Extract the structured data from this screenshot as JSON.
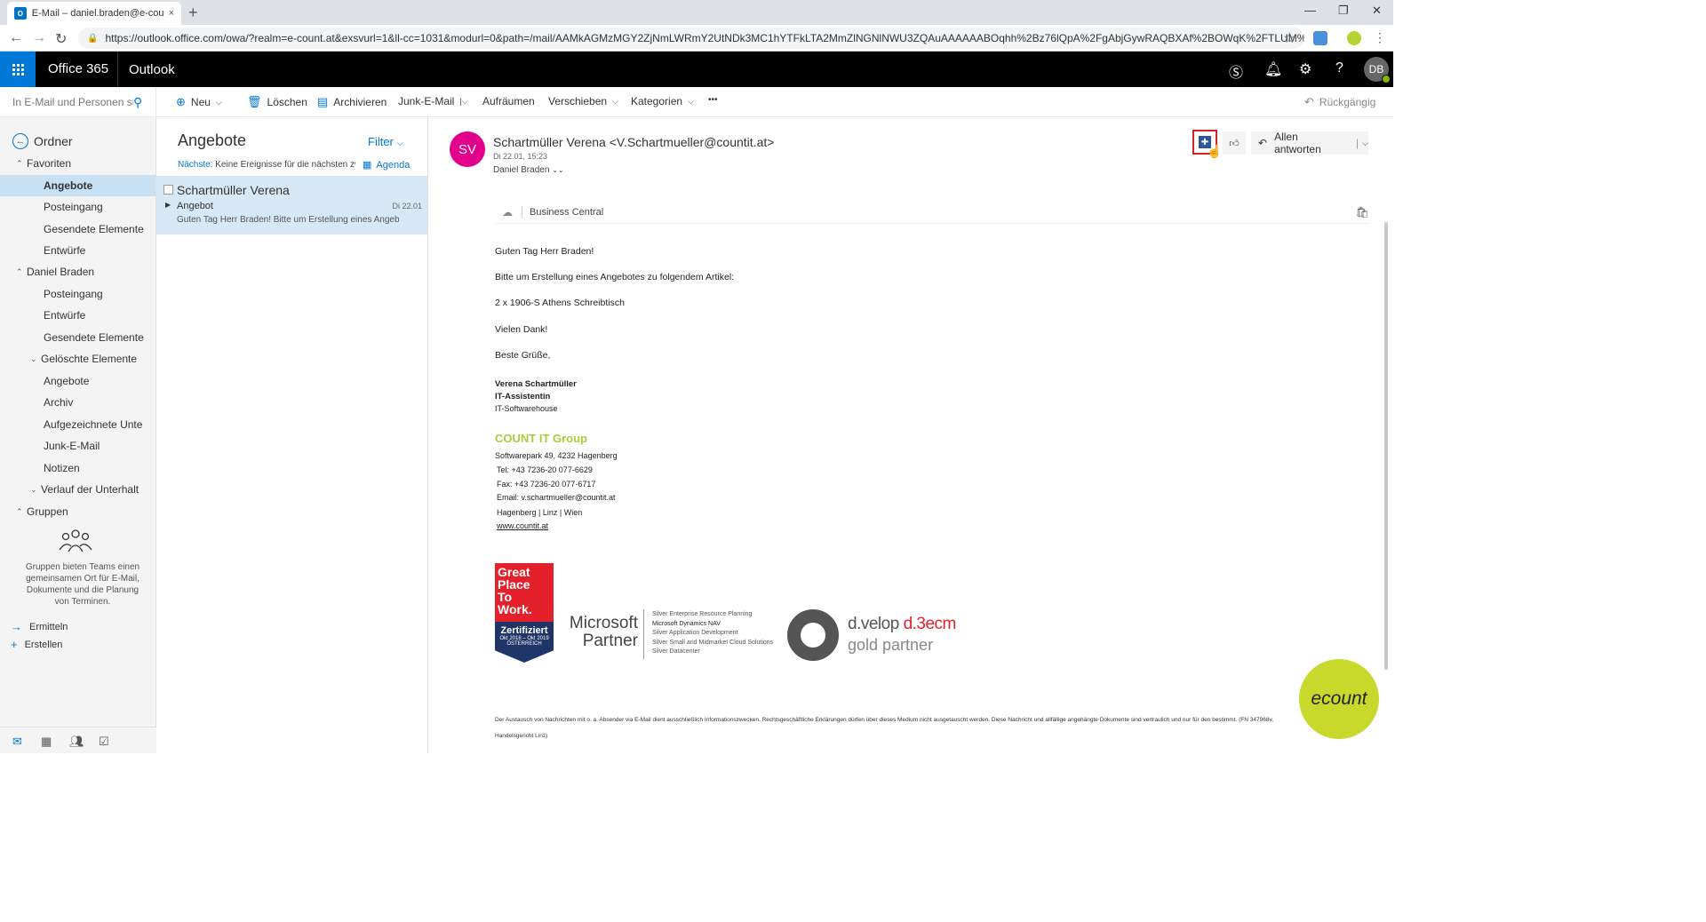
{
  "browser": {
    "tab_title": "E-Mail – daniel.braden@e-count…",
    "tab_close": "×",
    "new_tab": "+",
    "url": "https://outlook.office.com/owa/?realm=e-count.at&exsvurl=1&ll-cc=1031&modurl=0&path=/mail/AAMkAGMzMGY2ZjNmLWRmY2UtNDk3MC1hYTFkLTA2MmZlNGNlNWU3ZQAuAAAAAABOqhh%2Bz76lQpA%2FgAbjGywRAQBXAf%2BOWqK%2FTLUM%2Bnm..."
  },
  "suite": {
    "brand": "Office 365",
    "app": "Outlook"
  },
  "search": {
    "placeholder": "In E-Mail und Personen su..."
  },
  "commands": {
    "new": "Neu",
    "delete": "Löschen",
    "archive": "Archivieren",
    "junk": "Junk-E-Mail",
    "sweep": "Aufräumen",
    "move": "Verschieben",
    "categories": "Kategorien",
    "more": "•••",
    "undo": "Rückgängig"
  },
  "folders": {
    "header": "Ordner",
    "items": [
      {
        "label": "Favoriten"
      },
      {
        "label": "Angebote"
      },
      {
        "label": "Posteingang"
      },
      {
        "label": "Gesendete Elemente"
      },
      {
        "label": "Entwürfe"
      },
      {
        "label": "Daniel Braden"
      },
      {
        "label": "Posteingang"
      },
      {
        "label": "Entwürfe"
      },
      {
        "label": "Gesendete Elemente"
      },
      {
        "label": "Gelöschte Elemente"
      },
      {
        "label": "Angebote"
      },
      {
        "label": "Archiv"
      },
      {
        "label": "Aufgezeichnete Unte"
      },
      {
        "label": "Junk-E-Mail"
      },
      {
        "label": "Notizen"
      },
      {
        "label": "Verlauf der Unterhalt"
      },
      {
        "label": "Gruppen"
      }
    ],
    "groups_text": "Gruppen bieten Teams einen gemeinsamen Ort für E-Mail, Dokumente und die Planung von Terminen.",
    "discover": "Ermitteln",
    "create": "Erstellen"
  },
  "message_list": {
    "title": "Angebote",
    "filter": "Filter",
    "next_label": "Nächste:",
    "next_text": "Keine Ereignisse für die nächsten zw",
    "agenda": "Agenda",
    "messages": [
      {
        "from": "Schartmüller Verena",
        "subject": "Angebot",
        "date": "Di 22.01",
        "preview": "Guten Tag Herr Braden!  Bitte um Erstellung eines Angeb..."
      }
    ]
  },
  "reading": {
    "initials": "SV",
    "sender": "Schartmüller Verena <V.Schartmueller@countit.at>",
    "date": "Di 22.01, 15:23",
    "to": "Daniel Braden",
    "reply_all": "Allen antworten",
    "addin": "Business Central",
    "body": {
      "greeting": "Guten Tag Herr Braden!",
      "request": "Bitte um Erstellung eines Angebotes zu folgendem Artikel:",
      "item": "2 x 1906-S Athens Schreibtisch",
      "thanks": "Vielen Dank!",
      "regards": "Beste Grüße,",
      "sig_name": "Verena Schartmüller",
      "sig_role": "IT-Assistentin",
      "sig_dept": "IT-Softwarehouse",
      "company": "COUNT IT Group",
      "address": "Softwarepark 49, 4232 Hagenberg",
      "tel": "Tel:     +43 7236-20 077-6629",
      "fax": "Fax:     +43 7236-20 077-6717",
      "email": "Email: v.schartmueller@countit.at",
      "locations": "Hagenberg | Linz | Wien",
      "web": "www.countit.at"
    },
    "gptw": {
      "l1": "Great",
      "l2": "Place",
      "l3": "To",
      "l4": "Work.",
      "cert": "Zertifiziert",
      "period": "Okt 2018 – Okt 2019",
      "country": "ÖSTERREICH"
    },
    "ms_partner": {
      "l1": "Microsoft",
      "l2": "Partner",
      "c1": "Silver Enterprise Resource Planning",
      "c2": "Microsoft Dynamics NAV",
      "c3": "Silver Application Development",
      "c4": "Silver Small and Midmarket Cloud Solutions",
      "c5": "Silver Datacenter"
    },
    "dvelop": {
      "brand": "d.velop",
      "product": "d.3ecm",
      "level": "gold partner"
    },
    "ecount": "ecount",
    "disclaimer": "Der Austausch von Nachrichten mit o. a. Absender via E-Mail dient ausschließlich Informationszwecken. Rechtsgeschäftliche Erklärungen dürfen über dieses Medium nicht ausgetauscht werden. Diese Nachricht und allfällige angehängte Dokumente sind vertraulich und nur für den bestimmt. (FN 347968v, Handelsgericht Linz)"
  },
  "user": {
    "initials": "DB"
  },
  "colors": {
    "accent": "#0078d7",
    "suite_bar": "#000000",
    "selected": "#c7e0f4",
    "sender_avatar": "#e3008c",
    "count_green": "#a6ce39"
  }
}
